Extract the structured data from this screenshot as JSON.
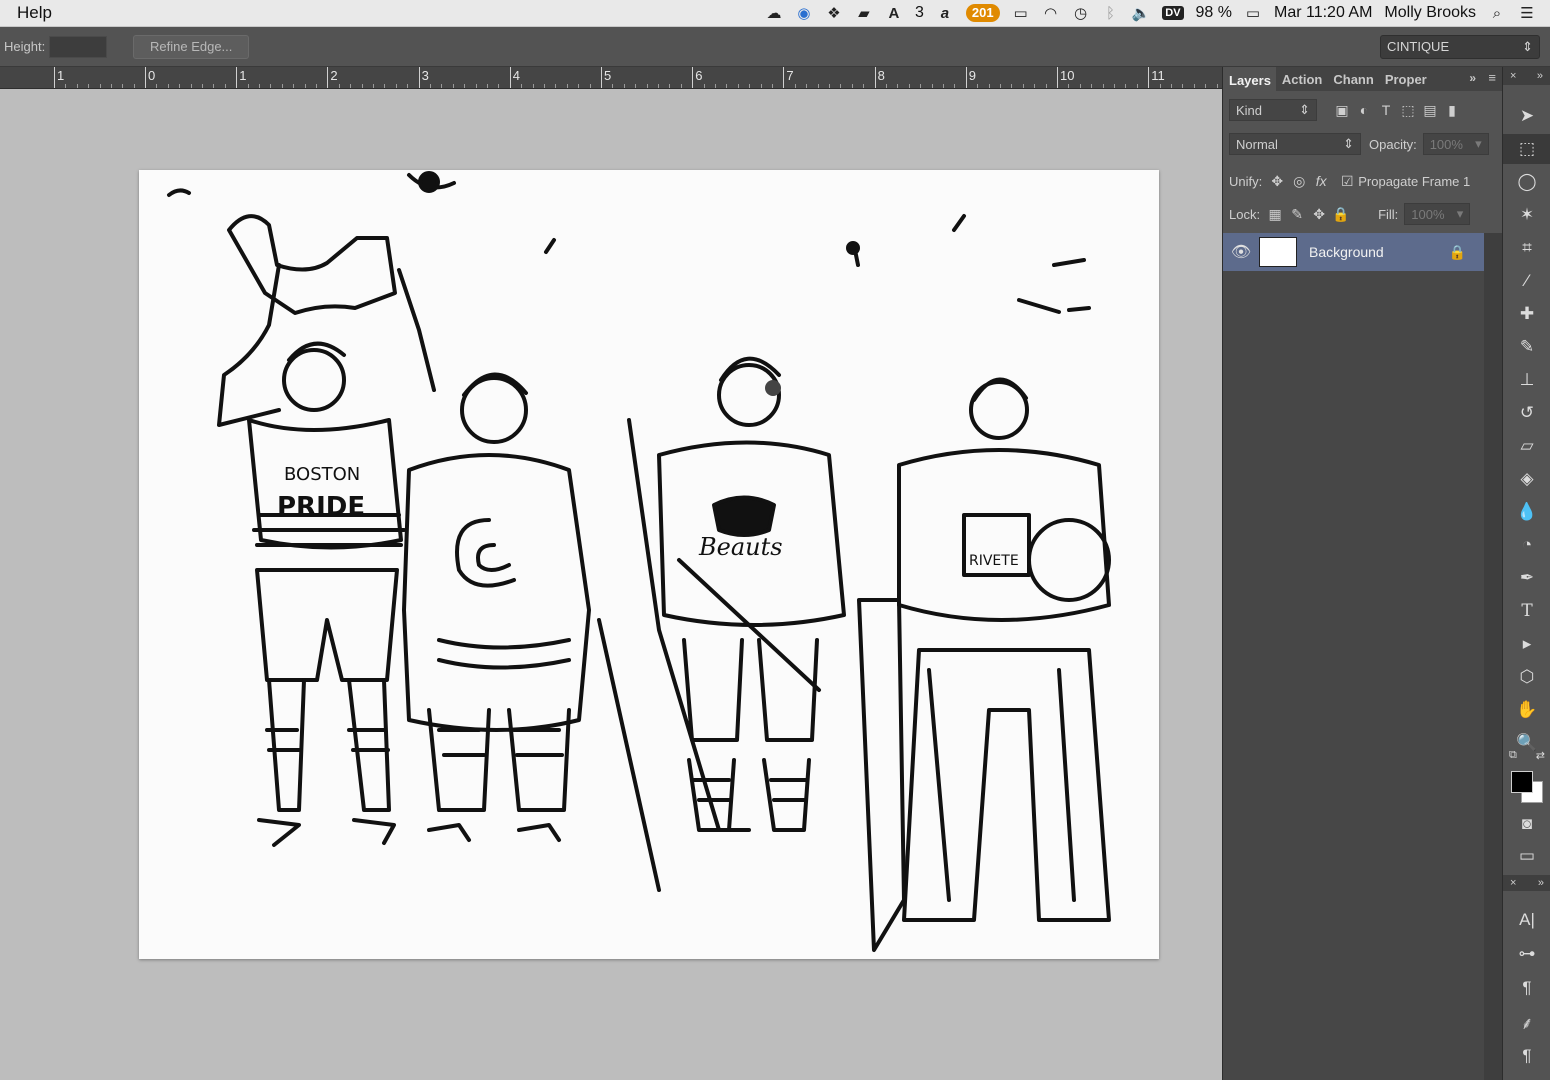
{
  "menubar": {
    "app_menu": "Help",
    "battery": "98 %",
    "badge_count": "201",
    "notifications": "3",
    "dv": "DV",
    "datetime": "Mar 11:20 AM",
    "user": "Molly Brooks"
  },
  "options": {
    "height_label": "Height:",
    "refine_edge": "Refine Edge...",
    "workspace": "CINTIQUE"
  },
  "ruler": {
    "labels": [
      "1",
      "0",
      "1",
      "2",
      "3",
      "4",
      "5",
      "6",
      "7",
      "8",
      "9",
      "10",
      "11"
    ]
  },
  "panel": {
    "tabs": [
      "Layers",
      "Action",
      "Chann",
      "Proper"
    ],
    "filter_kind": "Kind",
    "blend_mode": "Normal",
    "opacity_label": "Opacity:",
    "opacity_value": "100%",
    "unify_label": "Unify:",
    "propagate_label": "Propagate Frame 1",
    "lock_label": "Lock:",
    "fill_label": "Fill:",
    "fill_value": "100%",
    "layers": [
      {
        "name": "Background",
        "locked": true,
        "visible": true
      }
    ]
  },
  "tools": [
    "move-tool",
    "marquee-tool",
    "lasso-tool",
    "magic-wand-tool",
    "crop-tool",
    "eyedropper-tool",
    "healing-brush-tool",
    "brush-tool",
    "clone-stamp-tool",
    "history-brush-tool",
    "eraser-tool",
    "paint-bucket-tool",
    "blur-tool",
    "dodge-tool",
    "pen-tool",
    "type-tool",
    "path-selection-tool",
    "shape-tool",
    "hand-tool",
    "zoom-tool"
  ],
  "colors": {
    "foreground": "#000000",
    "background": "#ffffff",
    "selected_layer": "#5d6b8c"
  }
}
